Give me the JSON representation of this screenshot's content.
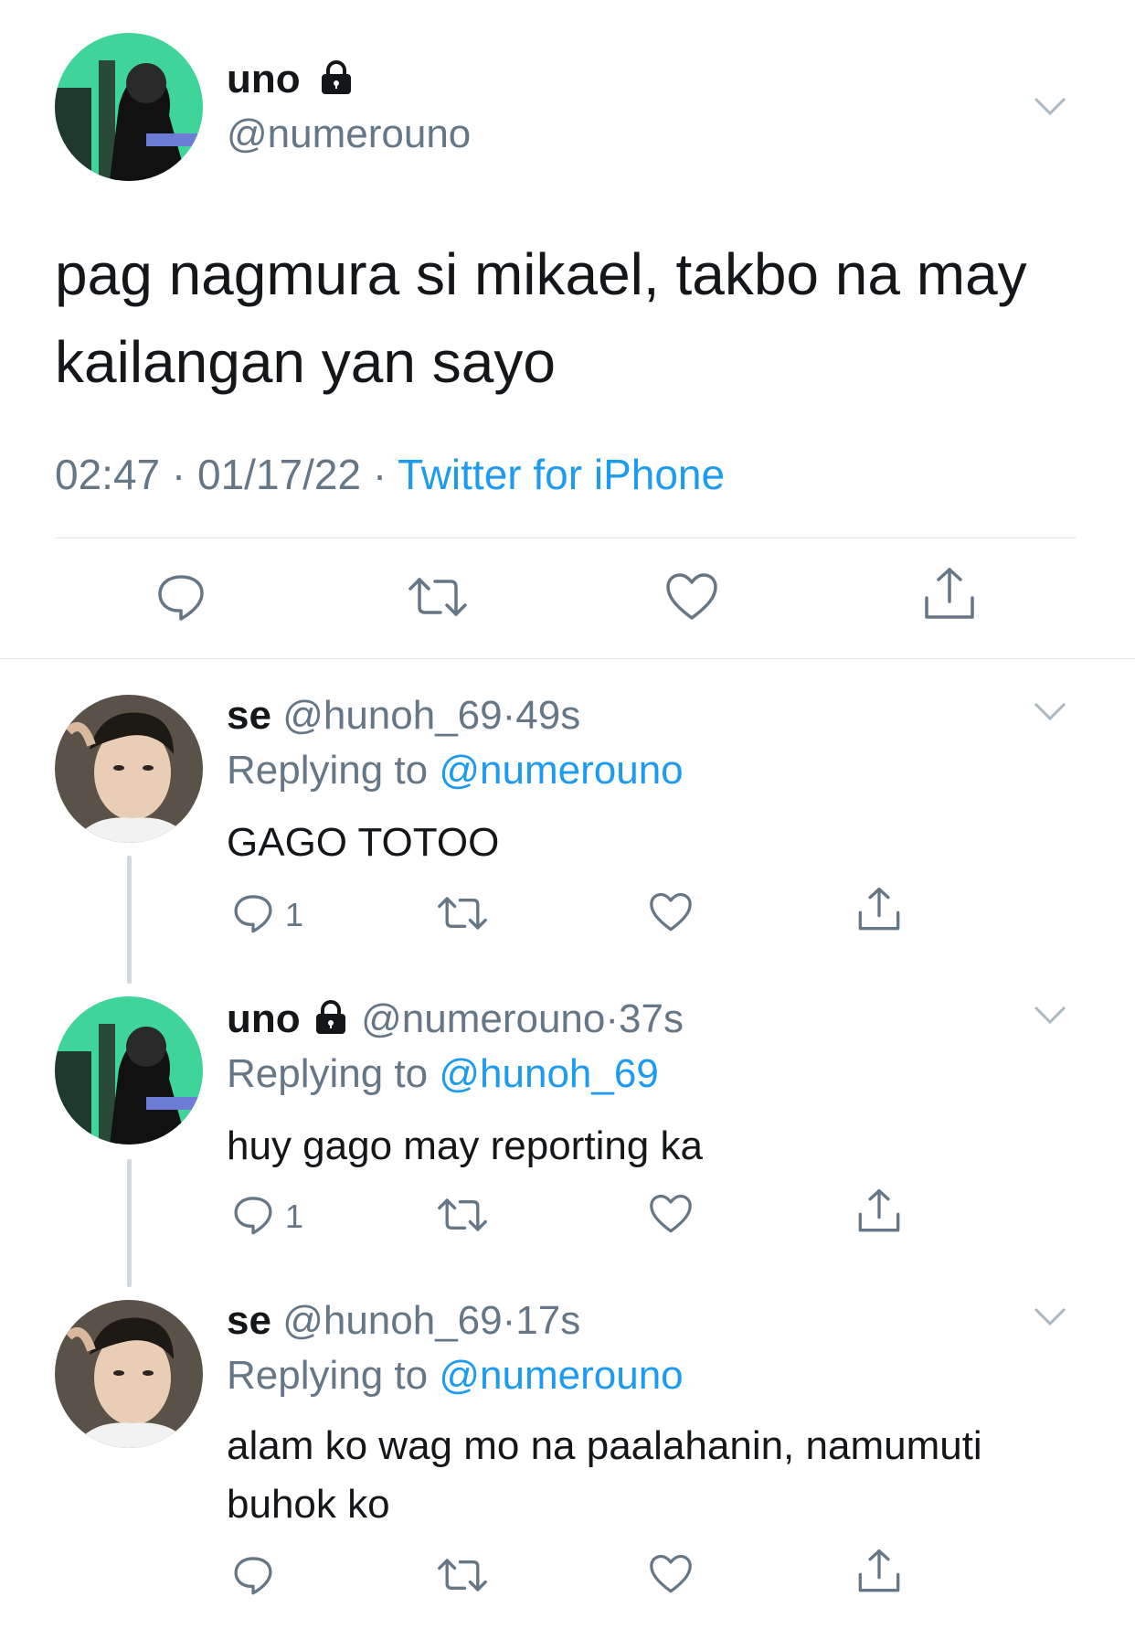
{
  "main_tweet": {
    "display_name": "uno",
    "handle": "@numerouno",
    "text": "pag nagmura si mikael, takbo na may kailangan yan sayo",
    "time": "02:47",
    "date": "01/17/22",
    "sep": "·",
    "source": "Twitter for iPhone",
    "avatar_icon": "avatar-green-photo",
    "lock_icon": "lock-icon"
  },
  "replies": [
    {
      "display_name": "se",
      "handle": "@hunoh_69",
      "sep": "·",
      "age": "49s",
      "replying_label": "Replying to",
      "replying_to": "@numerouno",
      "text": "GAGO TOTOO",
      "reply_count": "1"
    },
    {
      "display_name": "uno",
      "handle": "@numerouno",
      "sep": "·",
      "age": "37s",
      "replying_label": "Replying to",
      "replying_to": "@hunoh_69",
      "text": "huy gago may reporting ka",
      "reply_count": "1"
    },
    {
      "display_name": "se",
      "handle": "@hunoh_69",
      "sep": "·",
      "age": "17s",
      "replying_label": "Replying to",
      "replying_to": "@numerouno",
      "text": "alam ko wag mo na paalahanin, namumuti buhok ko",
      "reply_count": ""
    }
  ],
  "colors": {
    "link": "#1d9bf0",
    "secondary_text": "#657786",
    "divider": "#e1e8ed",
    "avatar_green": "#3fd49a"
  }
}
